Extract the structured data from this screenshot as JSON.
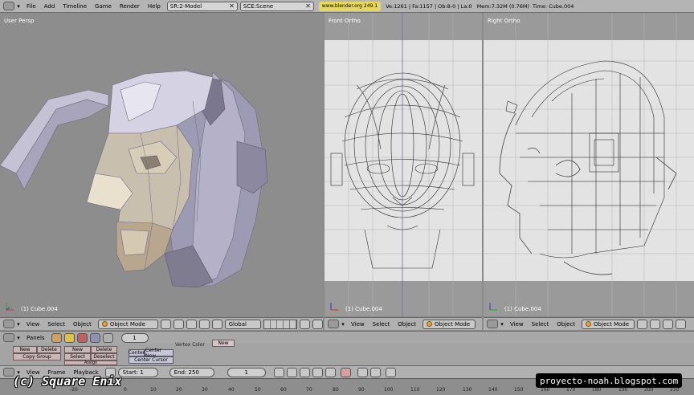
{
  "topbar": {
    "menus": [
      "File",
      "Add",
      "Timeline",
      "Game",
      "Render",
      "Help"
    ],
    "screen": "SR:2-Model",
    "scene": "SCE:Scene",
    "url": "www.blender.org 249.1",
    "stats": "Ve:1261 | Fa:1157 | Ob:8-0 | La:0",
    "memory": "Mem:7.32M (0.76M)",
    "time_label": "Time:",
    "object": "Cube.004"
  },
  "views": {
    "persp": {
      "label": "User Persp",
      "object": "(1) Cube.004"
    },
    "front": {
      "label": "Front Ortho",
      "object": "(1) Cube.004"
    },
    "right": {
      "label": "Right Ortho",
      "object": "(1) Cube.004"
    }
  },
  "view_header": {
    "menus": [
      "View",
      "Select",
      "Object"
    ],
    "mode": "Object Mode",
    "orientation": "Global"
  },
  "buttons": {
    "panels": "Panels",
    "frame": "1",
    "vertex_color": "Vertex Color",
    "new": "New",
    "delete": "Delete",
    "copy_group": "Copy Group",
    "select": "Select",
    "deselect": "Deselect",
    "assign": "Assign",
    "center": "Center",
    "center_new": "Center New",
    "center_cursor": "Center Cursor"
  },
  "timeline": {
    "menus": [
      "View",
      "Frame",
      "Playback"
    ],
    "start": "Start: 1",
    "end": "End: 250",
    "current": "1",
    "ticks": [
      "-20",
      "0",
      "10",
      "20",
      "30",
      "40",
      "50",
      "60",
      "70",
      "80",
      "90",
      "100",
      "110",
      "120",
      "130",
      "140",
      "150",
      "160",
      "170",
      "180",
      "190",
      "200",
      "210"
    ]
  },
  "watermarks": {
    "copyright": "(c) Square Enix",
    "site": "proyecto-noah.blogspot.com"
  },
  "colors": {
    "url_bg": "#e6d85a",
    "mode_dot": "#e8a431",
    "mesh_light": "#c9c6d8",
    "mesh_skin": "#b9a58e"
  }
}
